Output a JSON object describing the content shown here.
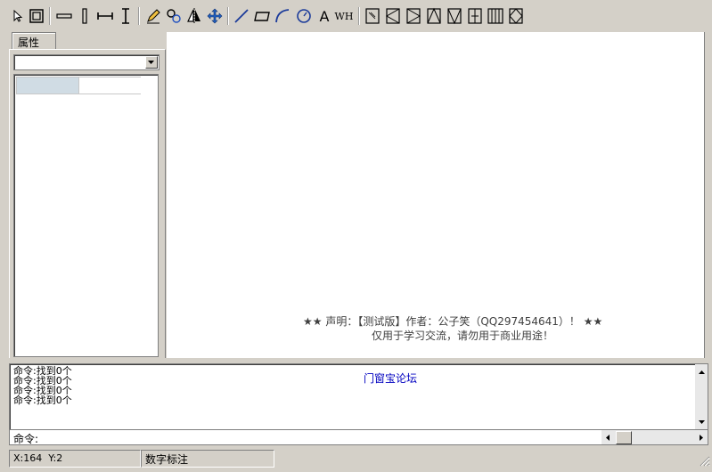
{
  "toolbar": {
    "buttons": [
      {
        "name": "select-arrow-icon"
      },
      {
        "name": "window-frame-icon"
      },
      {
        "name": "horizontal-bar-icon"
      },
      {
        "name": "vertical-bar-icon"
      },
      {
        "name": "horizontal-dimension-icon"
      },
      {
        "name": "vertical-dimension-icon"
      },
      {
        "name": "pencil-icon"
      },
      {
        "name": "link-icon"
      },
      {
        "name": "mirror-icon"
      },
      {
        "name": "move-icon"
      },
      {
        "name": "line-icon"
      },
      {
        "name": "rectangle-icon"
      },
      {
        "name": "arc-icon"
      },
      {
        "name": "circle-icon"
      },
      {
        "name": "text-icon",
        "glyph": "A"
      },
      {
        "name": "wh-size-icon",
        "glyph": "WH"
      },
      {
        "name": "hatch-panel-icon"
      },
      {
        "name": "left-triangle-panel-icon"
      },
      {
        "name": "right-triangle-panel-icon"
      },
      {
        "name": "up-triangle-panel-icon"
      },
      {
        "name": "down-triangle-panel-icon"
      },
      {
        "name": "split-panel-icon"
      },
      {
        "name": "grid-panel-icon"
      },
      {
        "name": "diamond-panel-icon"
      }
    ]
  },
  "properties": {
    "tab_label": "属性",
    "combo_value": ""
  },
  "canvas": {
    "notice_line1": "★★ 声明：【测试版】作者：公子笑（QQ297454641）！ ★★",
    "notice_line2": "仅用于学习交流，请勿用于商业用途！"
  },
  "command": {
    "history": [
      "命令:找到0个",
      "命令:找到0个",
      "命令:找到0个",
      "命令:找到0个"
    ],
    "forum_link": "门窗宝论坛",
    "prompt_label": "命令:"
  },
  "status": {
    "coords": "X:164  Y:2",
    "mode": "数字标注"
  }
}
